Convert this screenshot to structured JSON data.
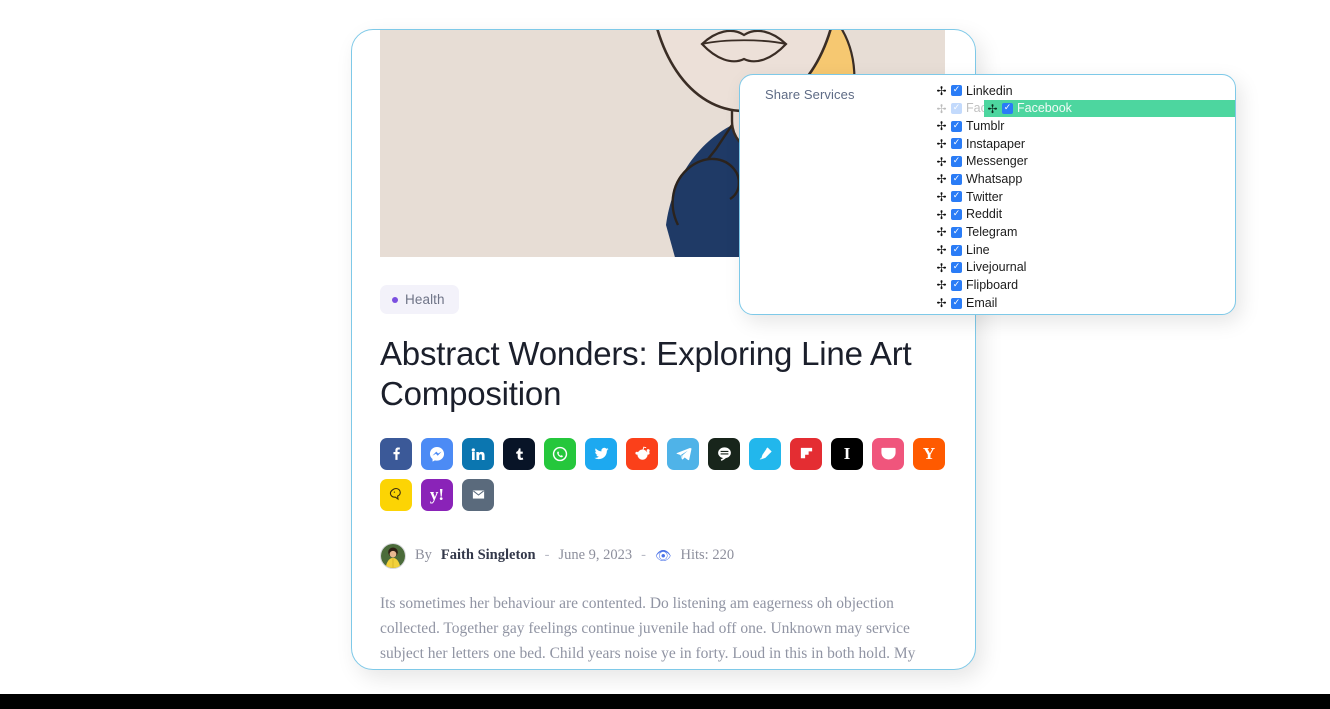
{
  "article": {
    "category": "Health",
    "category_dot_color": "#7b4fe0",
    "title": "Abstract Wonders: Exploring Line Art Composition",
    "byline": {
      "by_prefix": "By",
      "author": "Faith Singleton",
      "separator": "-",
      "date": "June 9, 2023",
      "hits_icon": "eye-icon",
      "hits": "Hits: 220"
    },
    "excerpt": "Its sometimes her behaviour are contented. Do listening am eagerness oh objection collected. Together gay feelings continue juvenile had off one. Unknown may service subject her letters one bed. Child years noise ye in forty. Loud in this in both hold. My entrance me is disposal bachelor remember relation.",
    "hero_alt": "line-art-illustration-woman-navy-jacket"
  },
  "share_buttons": [
    {
      "name": "facebook",
      "icon": "facebook-icon",
      "color": "#3b5998"
    },
    {
      "name": "messenger",
      "icon": "messenger-icon",
      "color": "#4c8bf5"
    },
    {
      "name": "linkedin",
      "icon": "linkedin-icon",
      "color": "#0b76b0"
    },
    {
      "name": "tumblr",
      "icon": "tumblr-icon",
      "color": "#081427"
    },
    {
      "name": "whatsapp",
      "icon": "whatsapp-icon",
      "color": "#25c73c"
    },
    {
      "name": "twitter",
      "icon": "twitter-icon",
      "color": "#1da9f0"
    },
    {
      "name": "reddit",
      "icon": "reddit-icon",
      "color": "#fb401a"
    },
    {
      "name": "telegram",
      "icon": "telegram-icon",
      "color": "#4fb3e8"
    },
    {
      "name": "line",
      "icon": "line-icon",
      "color": "#18251b"
    },
    {
      "name": "livejournal",
      "icon": "livejournal-icon",
      "color": "#22b7ec"
    },
    {
      "name": "flipboard",
      "icon": "flipboard-icon",
      "color": "#e42d32"
    },
    {
      "name": "instapaper",
      "icon": "instapaper-icon",
      "color": "#000000",
      "glyph": "I"
    },
    {
      "name": "pocket",
      "icon": "pocket-icon",
      "color": "#f0557c"
    },
    {
      "name": "hackernews",
      "icon": "hackernews-icon",
      "color": "#ff5a00",
      "glyph": "Y"
    },
    {
      "name": "kakao",
      "icon": "kakao-icon",
      "color": "#fcd404"
    },
    {
      "name": "yahoo",
      "icon": "yahoo-icon",
      "color": "#8a23b8",
      "glyph": "y!"
    },
    {
      "name": "email",
      "icon": "email-icon",
      "color": "#5a6a7c"
    }
  ],
  "share_services_panel": {
    "label": "Share Services",
    "drag_handle_icon": "move-arrows-icon",
    "checkbox_icon": "checked-checkbox-icon",
    "highlight_color": "#4dd69f",
    "checkbox_color": "#2a7cf6",
    "border_color": "#7ec9e8",
    "services": [
      {
        "label": "Linkedin",
        "checked": true,
        "state": "normal"
      },
      {
        "label": "Facebook",
        "checked": true,
        "state": "dragging-ghost"
      },
      {
        "label": "Tumblr",
        "checked": true,
        "state": "normal"
      },
      {
        "label": "Instapaper",
        "checked": true,
        "state": "normal"
      },
      {
        "label": "Messenger",
        "checked": true,
        "state": "normal"
      },
      {
        "label": "Whatsapp",
        "checked": true,
        "state": "normal"
      },
      {
        "label": "Twitter",
        "checked": true,
        "state": "normal"
      },
      {
        "label": "Reddit",
        "checked": true,
        "state": "normal"
      },
      {
        "label": "Telegram",
        "checked": true,
        "state": "normal"
      },
      {
        "label": "Line",
        "checked": true,
        "state": "normal"
      },
      {
        "label": "Livejournal",
        "checked": true,
        "state": "normal"
      },
      {
        "label": "Flipboard",
        "checked": true,
        "state": "normal"
      },
      {
        "label": "Email",
        "checked": true,
        "state": "normal"
      }
    ],
    "drag_preview": {
      "label": "Facebook",
      "checked": true
    }
  }
}
